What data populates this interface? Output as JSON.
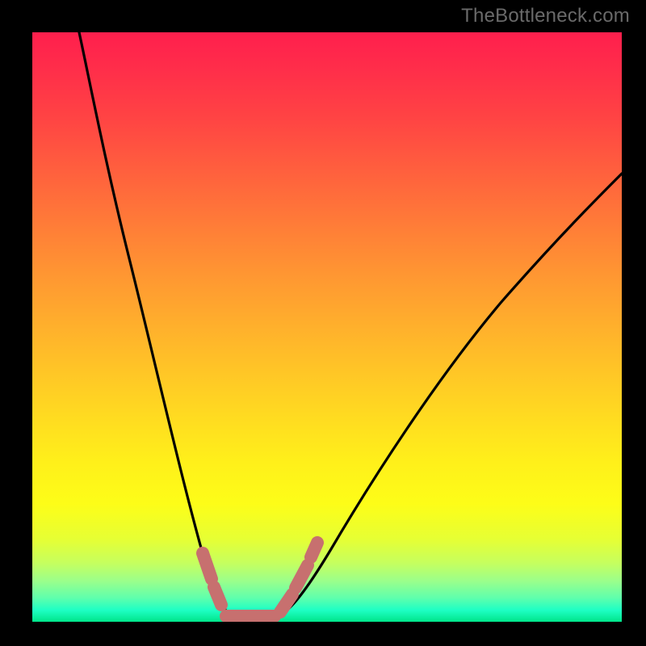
{
  "watermark": "TheBottleneck.com",
  "chart_data": {
    "type": "line",
    "title": "",
    "xlabel": "",
    "ylabel": "",
    "x_range": [
      0,
      100
    ],
    "y_range": [
      0,
      100
    ],
    "series": [
      {
        "name": "bottleneck-curve",
        "x": [
          8,
          10,
          13,
          16,
          19,
          22,
          25,
          28,
          30,
          32,
          34,
          36,
          40,
          44,
          48,
          52,
          58,
          66,
          76,
          88,
          100
        ],
        "y": [
          100,
          88,
          74,
          62,
          50,
          38,
          26,
          14,
          6,
          1,
          0,
          0,
          2,
          8,
          16,
          25,
          36,
          48,
          60,
          70,
          78
        ]
      }
    ],
    "markers": {
      "name": "highlight-band",
      "color": "#c7706f",
      "segments": [
        {
          "x": [
            29,
            31
          ],
          "y": [
            11,
            3
          ]
        },
        {
          "x": [
            32,
            42
          ],
          "y": [
            0.5,
            0.5
          ]
        },
        {
          "x": [
            42,
            44
          ],
          "y": [
            4,
            11
          ]
        },
        {
          "x": [
            44,
            46
          ],
          "y": [
            13,
            19
          ]
        }
      ]
    },
    "background_gradient": {
      "top": "#ff1f4d",
      "mid": "#fff01a",
      "bottom": "#00e58a"
    }
  }
}
